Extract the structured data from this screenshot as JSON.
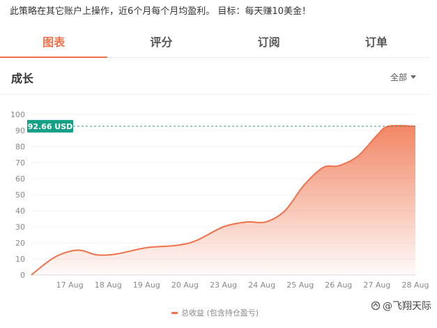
{
  "description": "此策略在其它账户上操作，近6个月每个月均盈利。 目标：每天赚10美金！",
  "tabs": [
    {
      "label": "图表",
      "active": true
    },
    {
      "label": "评分",
      "active": false
    },
    {
      "label": "订阅",
      "active": false
    },
    {
      "label": "订单",
      "active": false
    }
  ],
  "section": {
    "title": "成长",
    "filter_label": "全部"
  },
  "colors": {
    "accent": "#f0714a",
    "badge": "#16a085",
    "guide": "#2e9b83"
  },
  "watermark": {
    "text": "@飞翔天际",
    "icon": "share-icon"
  },
  "chart_data": {
    "type": "area",
    "ylim": [
      0,
      100
    ],
    "y_ticks": [
      0,
      10,
      20,
      30,
      40,
      50,
      60,
      70,
      80,
      90,
      100
    ],
    "x_tick_labels": [
      "17 Aug",
      "18 Aug",
      "19 Aug",
      "20 Aug",
      "23 Aug",
      "24 Aug",
      "25 Aug",
      "26 Aug",
      "27 Aug",
      "28 Aug"
    ],
    "x_range": [
      0,
      10
    ],
    "grid": true,
    "legend": "bottom-center",
    "current_value": 92.66,
    "current_label": "92.66 USD",
    "series": [
      {
        "name": "总收益 (包含持仓盈亏)",
        "points": [
          [
            0,
            0
          ],
          [
            0.6,
            11
          ],
          [
            1.2,
            15.5
          ],
          [
            1.7,
            12.5
          ],
          [
            2.2,
            13
          ],
          [
            3,
            17
          ],
          [
            3.8,
            18.5
          ],
          [
            4.3,
            21.5
          ],
          [
            5,
            30
          ],
          [
            5.6,
            33
          ],
          [
            6.1,
            33
          ],
          [
            6.6,
            40
          ],
          [
            7.1,
            56
          ],
          [
            7.6,
            67
          ],
          [
            8.0,
            68
          ],
          [
            8.5,
            74
          ],
          [
            9.0,
            87
          ],
          [
            9.3,
            92.66
          ],
          [
            10,
            92.66
          ]
        ]
      }
    ]
  }
}
